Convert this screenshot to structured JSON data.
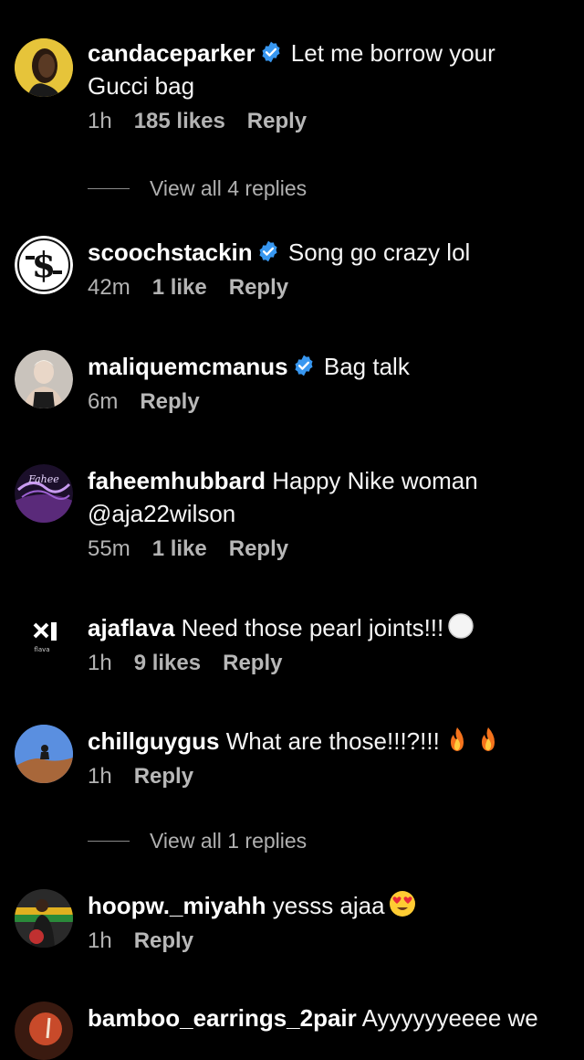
{
  "comments": [
    {
      "username": "candaceparker",
      "verified": true,
      "text": "Let me borrow your Gucci bag",
      "time": "1h",
      "likes": "185 likes",
      "reply": "Reply",
      "view_replies": "View all 4 replies",
      "avatar": "candaceparker-avatar"
    },
    {
      "username": "scoochstackin",
      "verified": true,
      "text": "Song go crazy lol",
      "time": "42m",
      "likes": "1 like",
      "reply": "Reply",
      "avatar": "dollar-logo-avatar"
    },
    {
      "username": "maliquemcmanus",
      "verified": true,
      "text": "Bag talk",
      "time": "6m",
      "reply": "Reply",
      "avatar": "maliquemcmanus-avatar"
    },
    {
      "username": "faheemhubbard",
      "verified": false,
      "text": "Happy Nike woman @aja22wilson",
      "time": "55m",
      "likes": "1 like",
      "reply": "Reply",
      "avatar": "script-logo-avatar"
    },
    {
      "username": "ajaflava",
      "verified": false,
      "text": "Need those pearl joints!!!",
      "emoji": "white-circle",
      "time": "1h",
      "likes": "9 likes",
      "reply": "Reply",
      "avatar": "ajaflava-logo-avatar"
    },
    {
      "username": "chillguygus",
      "verified": false,
      "text": "What are those!!!?!!!",
      "emoji": "fire fire",
      "time": "1h",
      "reply": "Reply",
      "view_replies": "View all 1 replies",
      "avatar": "chillguygus-avatar"
    },
    {
      "username": "hoopw._miyahh",
      "verified": false,
      "text": "yesss ajaa",
      "emoji": "heart-eyes",
      "time": "1h",
      "reply": "Reply",
      "avatar": "hoopw-avatar"
    },
    {
      "username": "bamboo_earrings_2pair",
      "verified": false,
      "text": "Ayyyyyyeeee we",
      "avatar": "bamboo-avatar"
    }
  ],
  "colors": {
    "background": "#000000",
    "verified": "#3897f0",
    "meta": "#b3b3b3"
  }
}
